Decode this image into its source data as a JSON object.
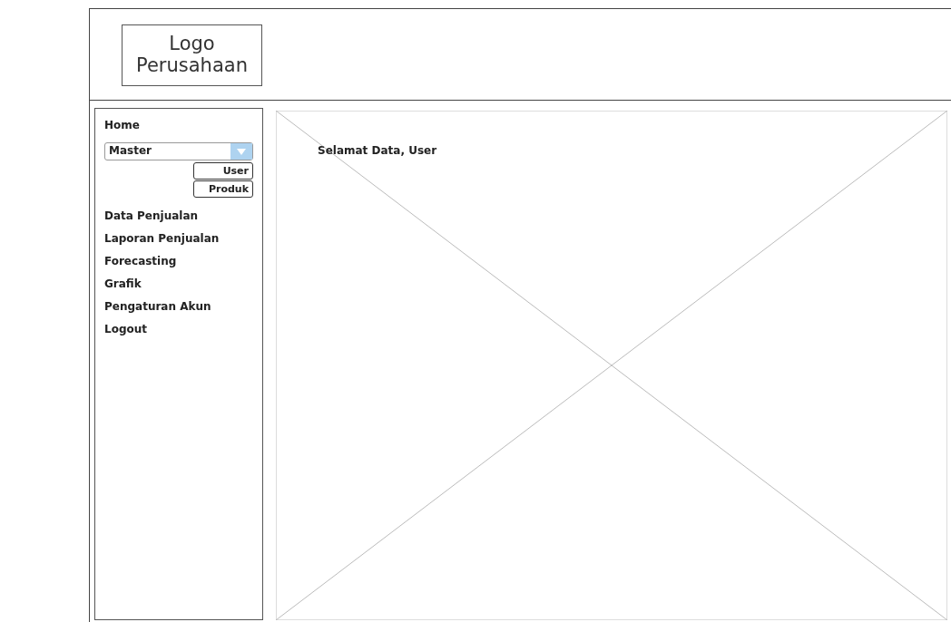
{
  "header": {
    "logo": "Logo Perusahaan"
  },
  "sidebar": {
    "items": [
      {
        "kind": "link",
        "label": "Home"
      },
      {
        "kind": "dropdown",
        "value": "Master",
        "submenu": [
          "User",
          "Produk"
        ]
      },
      {
        "kind": "link",
        "label": "Data Penjualan"
      },
      {
        "kind": "link",
        "label": "Laporan Penjualan"
      },
      {
        "kind": "link",
        "label": "Forecasting"
      },
      {
        "kind": "link",
        "label": "Grafik"
      },
      {
        "kind": "link",
        "label": "Pengaturan Akun"
      },
      {
        "kind": "link",
        "label": "Logout"
      }
    ]
  },
  "main": {
    "greeting": "Selamat Data, User"
  }
}
